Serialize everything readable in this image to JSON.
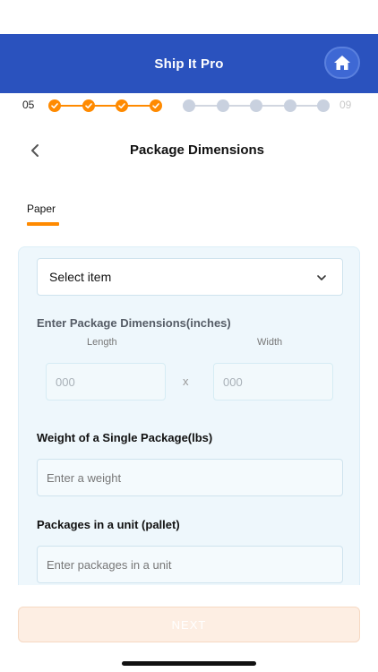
{
  "app": {
    "title": "Ship It Pro"
  },
  "header": {
    "home_icon": "home-icon"
  },
  "progress": {
    "current_step": "05",
    "total_steps": "09",
    "completed_dots": 4,
    "total_dots": 9,
    "accent_color": "#ff8a00",
    "inactive_color": "#c9d1df"
  },
  "page": {
    "title": "Package Dimensions",
    "back_icon": "chevron-left-icon"
  },
  "tabs": [
    {
      "label": "Paper",
      "active": true
    }
  ],
  "form": {
    "item_select": {
      "value": "Select item",
      "icon": "chevron-down-icon"
    },
    "dimensions": {
      "heading": "Enter Package Dimensions(inches)",
      "length_label": "Length",
      "width_label": "Width",
      "length_placeholder": "000",
      "width_placeholder": "000",
      "separator": "x"
    },
    "weight": {
      "label": "Weight of a Single Package(lbs)",
      "placeholder": "Enter a weight"
    },
    "packages": {
      "label": "Packages in a unit (pallet)",
      "placeholder": "Enter packages in a unit"
    }
  },
  "footer": {
    "next_label": "NEXT"
  },
  "colors": {
    "brand": "#2a52be",
    "accent": "#ff8a00",
    "card_bg": "#eef7fc"
  }
}
